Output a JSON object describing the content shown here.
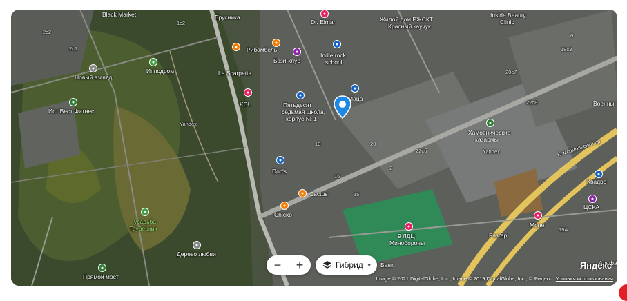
{
  "map": {
    "labels": {
      "black_market": "Black Market",
      "brusnika": "Брусника",
      "dr_elmar": "Dr. Elmar",
      "zhiloy_dom": "Жилой дом РЖСКТ",
      "krasny_kauchuk": "Красный каучук",
      "inside_beauty": "Inside Beauty",
      "clinic": "Clinic",
      "ribambel": "Рибамбель",
      "bazi_klub": "Бэзи-клуб",
      "indie_rock": "Indie rock",
      "school": "school",
      "la_scarpetta": "La Scarpetta",
      "novy_vzglyad": "Новый взгляд",
      "ippodrom": "Ипподром",
      "kdl": "KDL",
      "pyatidesyat": "Пятьдесят",
      "sedmaya_shkola": "седьмая школа,",
      "korpus": "корпус № 1",
      "matsa": "Мацa",
      "ist_vest": "Ист Вест Фитнес",
      "yandex_wm1": "Yandex",
      "khamovnicheskie": "Хамовнические",
      "kazarmy": "казармы",
      "voenny": "Военны",
      "docs": "Doc's",
      "cactus": "Cactus",
      "chicko": "Chicko",
      "komsomolsky": "Комсомольский пр",
      "kvadro": "Квадро",
      "tsska": "ЦСКА",
      "mone": "Mone",
      "usadba": "усадьба",
      "trubetskikh": "Трубецких",
      "ldts": "9 ЛДЦ",
      "minoborony": "Минобороны",
      "razgar": "Разгар",
      "derevo_lyubvi": "Дерево любви",
      "pryamoy_most": "Прямой мост",
      "bank": "Банк",
      "yandex_wm2": "Yandex",
      "alfa": "Альфа",
      "b_2c2": "2с2",
      "b_1c2": "1с2",
      "b_2c1": "2с1",
      "b_20c7": "20с7",
      "b_22c8": "22с8",
      "b_18c3": "18с3",
      "b_22cb": "22сб",
      "b_19a": "19А",
      "b_2": "2",
      "b_6": "6",
      "b_15": "15",
      "b_10": "10",
      "b_16": "16",
      "b_20": "20"
    }
  },
  "controls": {
    "zoom_out": "−",
    "zoom_in": "+",
    "layer_label": "Гибрид",
    "layer_arrow": "▼"
  },
  "footer": {
    "attribution": "Image © 2021 DigitalGlobe, Inc., Image © 2019 DigitalGlobe, Inc., © Яндекс",
    "terms": "Условия использования",
    "logo": "Яндекс"
  },
  "colors": {
    "accent_pin": "#1e88e5",
    "poi_food": "#f57c00",
    "poi_health": "#e91e63",
    "poi_sport": "#2e7d32",
    "poi_school": "#1565c0",
    "poi_park": "#43a047",
    "poi_shop": "#8e24aa",
    "road_major": "#e3c45c",
    "brand_red": "#e21f26"
  }
}
